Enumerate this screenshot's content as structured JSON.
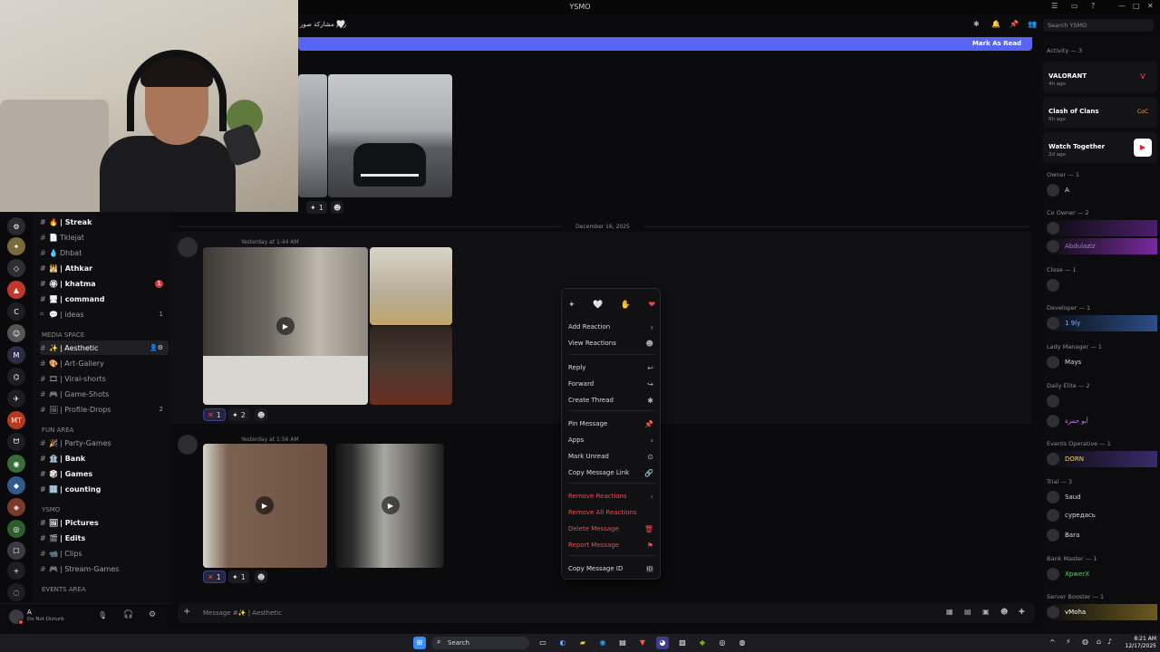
{
  "window": {
    "title": "YSMO"
  },
  "header": {
    "channel_name": "روم مشاركة صور",
    "search_placeholder": "Search YSMO"
  },
  "mark_read": {
    "label": "Mark As Read"
  },
  "date_divider": "December 16, 2025",
  "messages": [
    {
      "timestamp": "Yesterday at 1:44 AM",
      "reactions": [
        {
          "icon": "✕",
          "count": "1"
        },
        {
          "icon": "✦",
          "count": "2"
        }
      ]
    },
    {
      "timestamp": "Yesterday at 1:56 AM",
      "reactions": [
        {
          "icon": "✕",
          "count": "1"
        },
        {
          "icon": "✦",
          "count": "1"
        }
      ]
    }
  ],
  "top_message_reactions": [
    {
      "icon": "✦",
      "count": "1"
    }
  ],
  "channels": [
    {
      "emoji": "🔥",
      "label": "| Streak",
      "bright": true
    },
    {
      "emoji": "📄",
      "label": "Tklejat",
      "bright": false
    },
    {
      "emoji": "💧",
      "label": "Dhbat",
      "bright": false
    },
    {
      "emoji": "🕌",
      "label": "| Athkar",
      "bright": true
    },
    {
      "emoji": "🏵",
      "label": "| khatma",
      "bright": true,
      "badge": "1"
    },
    {
      "emoji": "🖥",
      "label": "| command",
      "bright": true
    },
    {
      "emoji": "💬",
      "label": "| ideas",
      "bright": false,
      "count": "1"
    }
  ],
  "categories": {
    "media": "MEDIA SPACE",
    "fun": "FUN AREA",
    "ysmo": "YSMO",
    "events": "EVENTS AREA"
  },
  "media_channels": [
    {
      "emoji": "✨",
      "label": "| Aesthetic",
      "active": true
    },
    {
      "emoji": "🎨",
      "label": "| Art-Gallery"
    },
    {
      "emoji": "🎞",
      "label": "| Viral-shorts"
    },
    {
      "emoji": "🎮",
      "label": "| Game-Shots"
    },
    {
      "emoji": "🖼",
      "label": "| Profile-Drops",
      "count": "2"
    }
  ],
  "fun_channels": [
    {
      "emoji": "🎉",
      "label": "| Party-Games",
      "bright": false
    },
    {
      "emoji": "🏦",
      "label": "| Bank",
      "bright": true
    },
    {
      "emoji": "🎲",
      "label": "| Games",
      "bright": true
    },
    {
      "emoji": "🔢",
      "label": "| counting",
      "bright": true
    }
  ],
  "ysmo_channels": [
    {
      "emoji": "🖼",
      "label": "| Pictures",
      "bright": true
    },
    {
      "emoji": "🎬",
      "label": "| Edits",
      "bright": true
    },
    {
      "emoji": "📹",
      "label": "| Clips",
      "bright": false
    },
    {
      "emoji": "🎮",
      "label": "| Stream-Games",
      "bright": false
    }
  ],
  "user_panel": {
    "name": "A",
    "status": "Do Not Disturb"
  },
  "context_menu": {
    "reactions": [
      "✦",
      "🤍",
      "✋",
      "❤"
    ],
    "items": [
      {
        "label": "Add Reaction",
        "icon": "›"
      },
      {
        "label": "View Reactions",
        "icon": "☻"
      },
      {
        "label": "Reply",
        "icon": "↩"
      },
      {
        "label": "Forward",
        "icon": "↪"
      },
      {
        "label": "Create Thread",
        "icon": "✱"
      },
      {
        "label": "Pin Message",
        "icon": "📌"
      },
      {
        "label": "Apps",
        "icon": "›"
      },
      {
        "label": "Mark Unread",
        "icon": "⊙"
      },
      {
        "label": "Copy Message Link",
        "icon": "🔗"
      },
      {
        "label": "Remove Reactions",
        "icon": "›"
      },
      {
        "label": "Remove All Reactions",
        "icon": ""
      },
      {
        "label": "Delete Message",
        "icon": "🗑"
      },
      {
        "label": "Report Message",
        "icon": "⚑"
      },
      {
        "label": "Copy Message ID",
        "icon": "ID"
      }
    ]
  },
  "composer": {
    "placeholder": "Message #✨ | Aesthetic"
  },
  "members": {
    "activity_header": "Activity — 3",
    "activities": [
      {
        "name": "VALORANT",
        "time": "4h ago",
        "logo_color": "#ff4655",
        "logo_text": "V"
      },
      {
        "name": "Clash of Clans",
        "time": "6h ago",
        "logo_color": "#f2a23a",
        "logo_text": "CoC"
      },
      {
        "name": "Watch Together",
        "time": "2d ago",
        "logo_color": "#ffffff",
        "logo_text": "▶"
      }
    ],
    "groups": [
      {
        "header": "Owner — 1",
        "members": [
          "A"
        ]
      },
      {
        "header": "Co Owner — 2",
        "members": [
          "",
          "Abdulaziz"
        ]
      },
      {
        "header": "Close — 1",
        "members": [
          ""
        ]
      },
      {
        "header": "Developer — 1",
        "members": [
          "1 9ly"
        ]
      },
      {
        "header": "Lady Manager — 1",
        "members": [
          "Mays"
        ]
      },
      {
        "header": "Daily Elite — 2",
        "members": [
          "",
          "أبو حمزة"
        ]
      },
      {
        "header": "Events Operative — 1",
        "members": [
          "DORN"
        ]
      },
      {
        "header": "Trial — 3",
        "members": [
          "Saud",
          "суредась",
          "Bara"
        ]
      },
      {
        "header": "Bank Master — 1",
        "members": [
          "XpwerX"
        ]
      },
      {
        "header": "Server Booster — 1",
        "members": [
          "vMoha"
        ]
      }
    ]
  },
  "taskbar": {
    "search_label": "Search",
    "time": "8:21 AM",
    "date": "12/17/2025"
  },
  "colors": {
    "accent": "#5865f2",
    "danger": "#f04a4f",
    "background": "#0b0b0d"
  }
}
